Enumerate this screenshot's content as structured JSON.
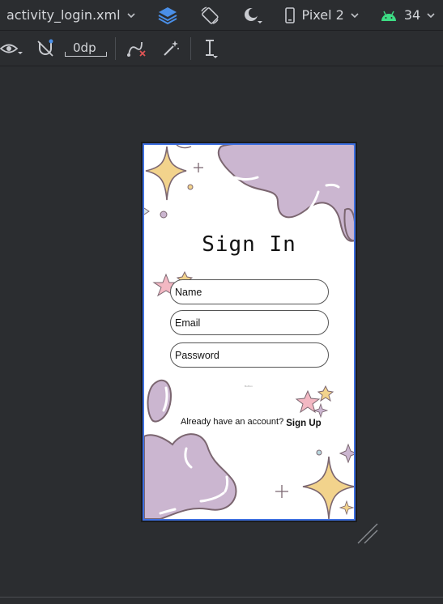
{
  "toolbar": {
    "file_name": "activity_login.xml",
    "device": "Pixel 2",
    "api_level": "34",
    "margin_value": "0dp"
  },
  "screen": {
    "title": "Sign In",
    "fields": [
      {
        "label": "Name"
      },
      {
        "label": "Email"
      },
      {
        "label": "Password"
      }
    ],
    "tiny_text": "Button",
    "prompt": "Already have an account?",
    "signup_link": "Sign Up"
  },
  "colors": {
    "accent_blue": "#3d6fe0",
    "android_green": "#3ddc84",
    "blob_purple": "#cbb6d0",
    "star_yellow": "#f2d38c",
    "star_pink": "#f3b8c3"
  }
}
